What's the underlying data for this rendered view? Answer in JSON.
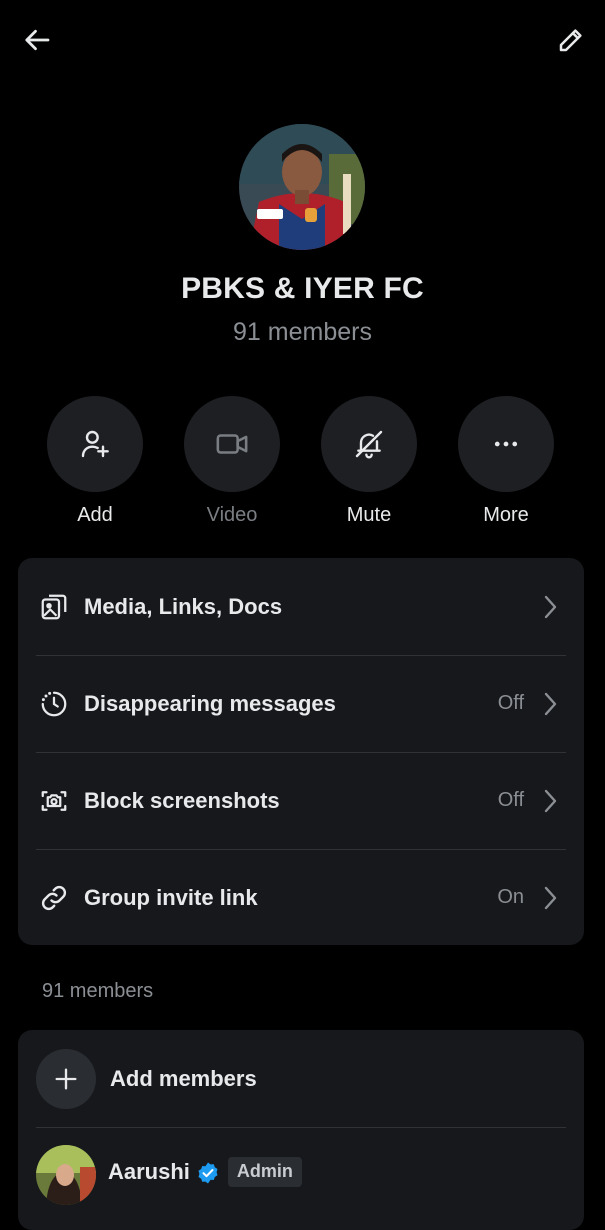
{
  "header": {
    "back_icon": "arrow-left-icon",
    "edit_icon": "pencil-icon"
  },
  "group": {
    "name": "PBKS & IYER FC",
    "members_label": "91 members"
  },
  "actions": [
    {
      "label": "Add",
      "icon": "add-person-icon",
      "enabled": true
    },
    {
      "label": "Video",
      "icon": "video-icon",
      "enabled": false
    },
    {
      "label": "Mute",
      "icon": "bell-off-icon",
      "enabled": true
    },
    {
      "label": "More",
      "icon": "more-dots-icon",
      "enabled": true
    }
  ],
  "settings": [
    {
      "title": "Media, Links, Docs",
      "value": "",
      "icon": "media-icon"
    },
    {
      "title": "Disappearing messages",
      "value": "Off",
      "icon": "timer-icon"
    },
    {
      "title": "Block screenshots",
      "value": "Off",
      "icon": "camera-block-icon"
    },
    {
      "title": "Group invite link",
      "value": "On",
      "icon": "link-icon"
    }
  ],
  "members_section": {
    "label": "91 members",
    "add_label": "Add members",
    "members": [
      {
        "name": "Aarushi",
        "verified": true,
        "badge": "Admin"
      }
    ]
  },
  "colors": {
    "background": "#000000",
    "card": "#16181c",
    "circle": "#1d1f23",
    "text": "#e7e9ea",
    "muted": "#8b8f94",
    "verified": "#1d9bf0"
  }
}
